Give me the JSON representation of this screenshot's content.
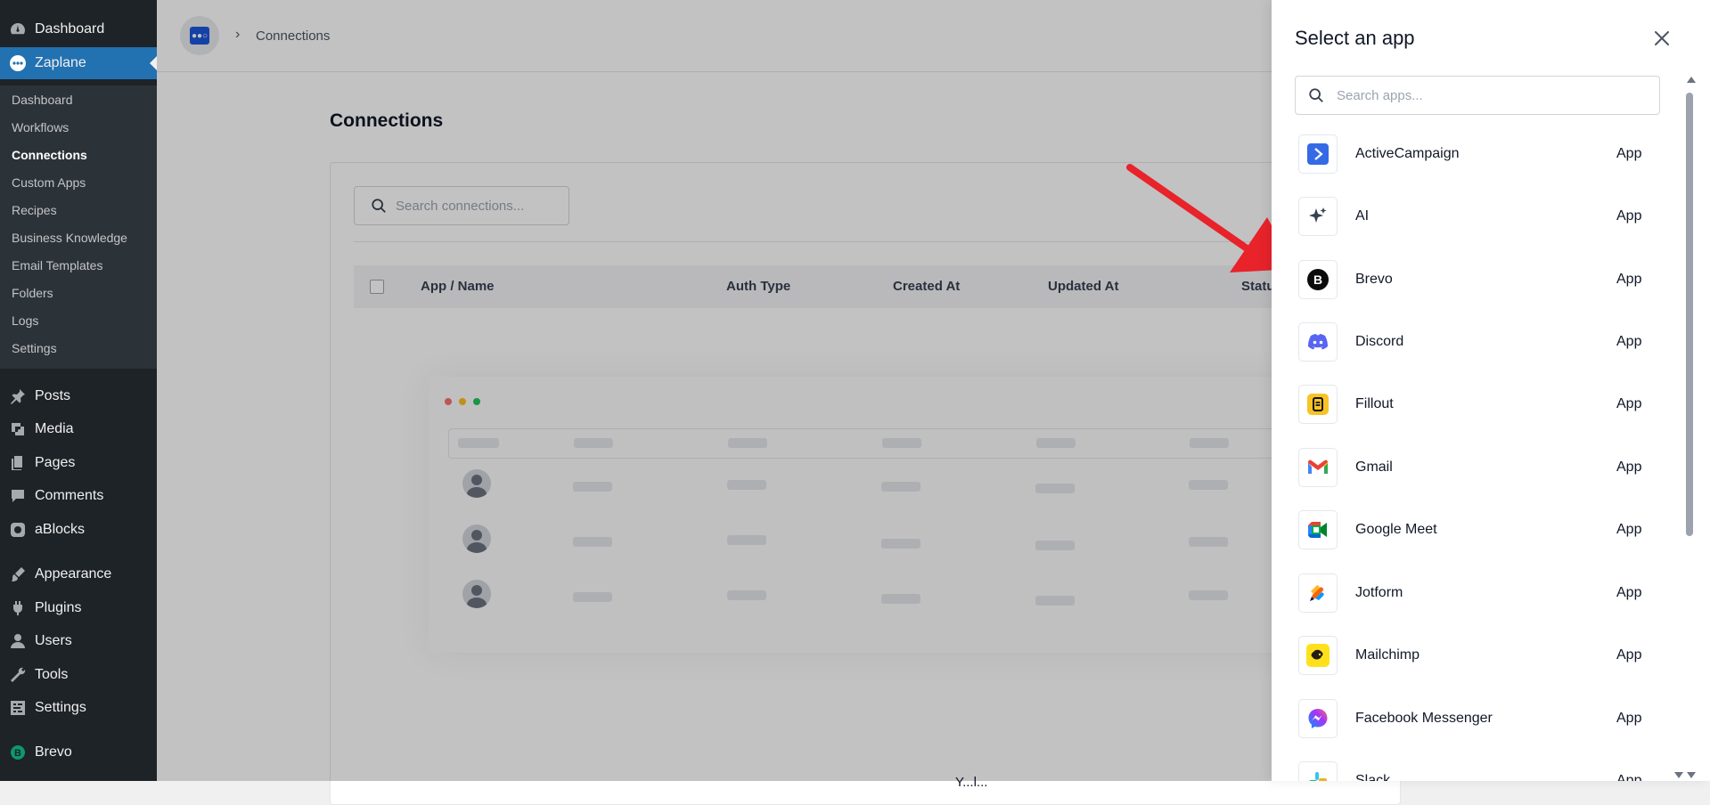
{
  "sidebar": {
    "top": [
      {
        "label": "Dashboard",
        "icon": "dashboard-icon"
      },
      {
        "label": "Zaplane",
        "icon": "zaplane-icon"
      }
    ],
    "submenu": [
      {
        "label": "Dashboard"
      },
      {
        "label": "Workflows"
      },
      {
        "label": "Connections"
      },
      {
        "label": "Custom Apps"
      },
      {
        "label": "Recipes"
      },
      {
        "label": "Business Knowledge"
      },
      {
        "label": "Email Templates"
      },
      {
        "label": "Folders"
      },
      {
        "label": "Logs"
      },
      {
        "label": "Settings"
      }
    ],
    "menu": [
      {
        "label": "Posts",
        "icon": "pin-icon"
      },
      {
        "label": "Media",
        "icon": "media-icon"
      },
      {
        "label": "Pages",
        "icon": "pages-icon"
      },
      {
        "label": "Comments",
        "icon": "comment-icon"
      },
      {
        "label": "aBlocks",
        "icon": "ablocks-icon"
      },
      {
        "label": "Appearance",
        "icon": "brush-icon"
      },
      {
        "label": "Plugins",
        "icon": "plug-icon"
      },
      {
        "label": "Users",
        "icon": "user-icon"
      },
      {
        "label": "Tools",
        "icon": "wrench-icon"
      },
      {
        "label": "Settings",
        "icon": "settings-icon"
      },
      {
        "label": "Brevo",
        "icon": "brevo-icon"
      }
    ]
  },
  "breadcrumb": {
    "current": "Connections",
    "separator": "›"
  },
  "page": {
    "title": "Connections",
    "search_placeholder": "Search connections...",
    "columns": [
      "App / Name",
      "Auth Type",
      "Created At",
      "Updated At",
      "Statu"
    ],
    "bottom_fragment": "Y...l..."
  },
  "drawer": {
    "title": "Select an app",
    "search_placeholder": "Search apps...",
    "apps": [
      {
        "name": "ActiveCampaign",
        "type": "App",
        "icon": "activecampaign-icon"
      },
      {
        "name": "AI",
        "type": "App",
        "icon": "ai-sparkle-icon"
      },
      {
        "name": "Brevo",
        "type": "App",
        "icon": "brevo-icon"
      },
      {
        "name": "Discord",
        "type": "App",
        "icon": "discord-icon"
      },
      {
        "name": "Fillout",
        "type": "App",
        "icon": "fillout-icon"
      },
      {
        "name": "Gmail",
        "type": "App",
        "icon": "gmail-icon"
      },
      {
        "name": "Google Meet",
        "type": "App",
        "icon": "google-meet-icon"
      },
      {
        "name": "Jotform",
        "type": "App",
        "icon": "jotform-icon"
      },
      {
        "name": "Mailchimp",
        "type": "App",
        "icon": "mailchimp-icon"
      },
      {
        "name": "Facebook Messenger",
        "type": "App",
        "icon": "messenger-icon"
      },
      {
        "name": "Slack",
        "type": "App",
        "icon": "slack-icon"
      }
    ]
  },
  "colors": {
    "sidebar_bg": "#1d2327",
    "sidebar_active": "#2271b1",
    "annotation_arrow": "#e8232a"
  }
}
